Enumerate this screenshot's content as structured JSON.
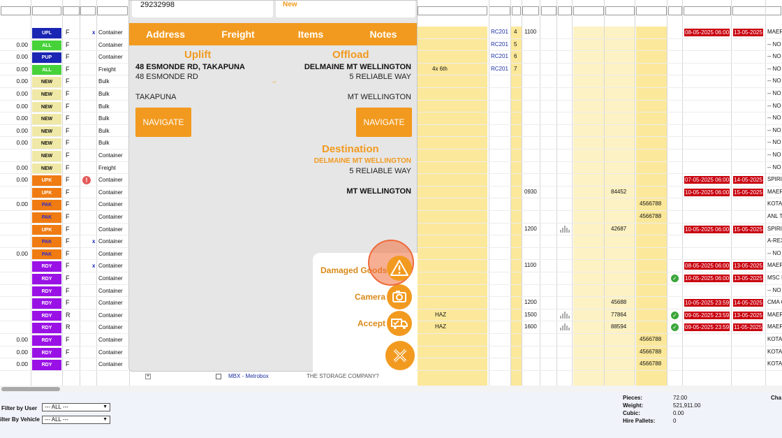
{
  "grid": {
    "rows": [
      {
        "amount": "",
        "status": "UPL",
        "cls": "st-upl",
        "f": "F",
        "type": "Container",
        "mark": "x"
      },
      {
        "amount": "0.00",
        "status": "ALL",
        "cls": "st-all",
        "f": "F",
        "type": "Container"
      },
      {
        "amount": "0.00",
        "status": "PUP",
        "cls": "st-pup",
        "f": "F",
        "type": "Container"
      },
      {
        "amount": "0.00",
        "status": "ALL",
        "cls": "st-all",
        "f": "F",
        "type": "Freight"
      },
      {
        "amount": "0.00",
        "status": "NEW",
        "cls": "st-new",
        "f": "F",
        "type": "Bulk"
      },
      {
        "amount": "0.00",
        "status": "NEW",
        "cls": "st-new",
        "f": "F",
        "type": "Bulk"
      },
      {
        "amount": "0.00",
        "status": "NEW",
        "cls": "st-new",
        "f": "F",
        "type": "Bulk"
      },
      {
        "amount": "0.00",
        "status": "NEW",
        "cls": "st-new",
        "f": "F",
        "type": "Bulk"
      },
      {
        "amount": "0.00",
        "status": "NEW",
        "cls": "st-new",
        "f": "F",
        "type": "Bulk"
      },
      {
        "amount": "0.00",
        "status": "NEW",
        "cls": "st-new",
        "f": "F",
        "type": "Bulk"
      },
      {
        "amount": "",
        "status": "NEW",
        "cls": "st-new",
        "f": "F",
        "type": "Container"
      },
      {
        "amount": "0.00",
        "status": "NEW",
        "cls": "st-new",
        "f": "F",
        "type": "Freight"
      },
      {
        "amount": "0.00",
        "status": "UPK",
        "cls": "st-upk",
        "f": "F",
        "type": "Container",
        "warn": "!"
      },
      {
        "amount": "",
        "status": "UPK",
        "cls": "st-upk",
        "f": "F",
        "type": "Container"
      },
      {
        "amount": "0.00",
        "status": "PAK",
        "cls": "st-pak",
        "f": "F",
        "type": "Container"
      },
      {
        "amount": "",
        "status": "PAK",
        "cls": "st-pak",
        "f": "F",
        "type": "Container"
      },
      {
        "amount": "",
        "status": "UPK",
        "cls": "st-upk",
        "f": "F",
        "type": "Container"
      },
      {
        "amount": "",
        "status": "PAK",
        "cls": "st-pak",
        "f": "F",
        "type": "Container",
        "mark": "x"
      },
      {
        "amount": "0.00",
        "status": "PAK",
        "cls": "st-pak",
        "f": "F",
        "type": "Container"
      },
      {
        "amount": "",
        "status": "RDY",
        "cls": "st-rdy",
        "f": "F",
        "type": "Container",
        "mark": "x"
      },
      {
        "amount": "",
        "status": "RDY",
        "cls": "st-rdy",
        "f": "F",
        "type": "Container"
      },
      {
        "amount": "",
        "status": "RDY",
        "cls": "st-rdy",
        "f": "F",
        "type": "Container"
      },
      {
        "amount": "",
        "status": "RDY",
        "cls": "st-rdy",
        "f": "F",
        "type": "Container"
      },
      {
        "amount": "",
        "status": "RDY",
        "cls": "st-rdy",
        "f": "R",
        "type": "Container"
      },
      {
        "amount": "",
        "status": "RDY",
        "cls": "st-rdy",
        "f": "R",
        "type": "Container"
      },
      {
        "amount": "0.00",
        "status": "RDY",
        "cls": "st-rdy",
        "f": "F",
        "type": "Container"
      },
      {
        "amount": "0.00",
        "status": "RDY",
        "cls": "st-rdy",
        "f": "F",
        "type": "Container"
      },
      {
        "amount": "0.00",
        "status": "RDY",
        "cls": "st-rdy",
        "f": "F",
        "type": "Container"
      }
    ],
    "cells": [
      {
        "text": "RC201",
        "row": 0,
        "col": "rc",
        "link": true
      },
      {
        "text": "4",
        "row": 0,
        "col": "seq"
      },
      {
        "text": "1100",
        "row": 0,
        "col": "time"
      },
      {
        "text": "RC201",
        "row": 1,
        "col": "rc",
        "link": true
      },
      {
        "text": "5",
        "row": 1,
        "col": "seq"
      },
      {
        "text": "RC201",
        "row": 2,
        "col": "rc",
        "link": true
      },
      {
        "text": "6",
        "row": 2,
        "col": "seq"
      },
      {
        "text": "RC201",
        "row": 3,
        "col": "rc",
        "link": true
      },
      {
        "text": "7",
        "row": 3,
        "col": "seq"
      },
      {
        "text": "4x 6th",
        "row": 3,
        "col": "note"
      },
      {
        "text": "0930",
        "row": 13,
        "col": "time"
      },
      {
        "text": "84452",
        "row": 13,
        "col": "num1"
      },
      {
        "text": "4566788",
        "row": 14,
        "col": "num2"
      },
      {
        "text": "4566788",
        "row": 15,
        "col": "num2"
      },
      {
        "text": "1200",
        "row": 16,
        "col": "time"
      },
      {
        "text": "42687",
        "row": 16,
        "col": "num1"
      },
      {
        "text": "1100",
        "row": 19,
        "col": "time"
      },
      {
        "text": "1200",
        "row": 22,
        "col": "time"
      },
      {
        "text": "45688",
        "row": 22,
        "col": "num1"
      },
      {
        "text": "HAZ",
        "row": 23,
        "col": "haz"
      },
      {
        "text": "1500",
        "row": 23,
        "col": "time"
      },
      {
        "text": "77864",
        "row": 23,
        "col": "num1"
      },
      {
        "text": "HAZ",
        "row": 24,
        "col": "haz"
      },
      {
        "text": "1600",
        "row": 24,
        "col": "time"
      },
      {
        "text": "88594",
        "row": 24,
        "col": "num1"
      },
      {
        "text": "4566788",
        "row": 25,
        "col": "num2"
      },
      {
        "text": "4566788",
        "row": 26,
        "col": "num2"
      },
      {
        "text": "4566788",
        "row": 27,
        "col": "num2"
      }
    ],
    "dates": [
      {
        "row": 0,
        "a": "08-05-2025 06:00",
        "b": "13-05-2025",
        "c": "MAER"
      },
      {
        "row": 12,
        "a": "07-05-2025 06:00",
        "b": "14-05-2025",
        "c": "SPIRI"
      },
      {
        "row": 13,
        "a": "10-05-2025 06:00",
        "b": "15-05-2025",
        "c": "MAER"
      },
      {
        "row": 16,
        "a": "10-05-2025 06:00",
        "b": "15-05-2025",
        "c": "SPIRI"
      },
      {
        "row": 19,
        "a": "08-05-2025 06:00",
        "b": "13-05-2025",
        "c": "MAER"
      },
      {
        "row": 20,
        "a": "10-05-2025 06:00",
        "b": "13-05-2025",
        "c": "MSC I"
      },
      {
        "row": 22,
        "a": "10-05-2025 23:59",
        "b": "14-05-2025",
        "c": "CMA C"
      },
      {
        "row": 23,
        "a": "09-05-2025 23:59",
        "b": "13-05-2025",
        "c": "MAER"
      },
      {
        "row": 24,
        "a": "09-05-2025 23:59",
        "b": "11-05-2025",
        "c": "MAER"
      }
    ],
    "right_text": [
      {
        "row": 1,
        "text": "-- NO"
      },
      {
        "row": 2,
        "text": "-- NO"
      },
      {
        "row": 3,
        "text": "-- NO"
      },
      {
        "row": 4,
        "text": "-- NO"
      },
      {
        "row": 5,
        "text": "-- NO"
      },
      {
        "row": 6,
        "text": "-- NO"
      },
      {
        "row": 7,
        "text": "-- NO"
      },
      {
        "row": 8,
        "text": "-- NO"
      },
      {
        "row": 9,
        "text": "-- NO"
      },
      {
        "row": 10,
        "text": "-- NO"
      },
      {
        "row": 11,
        "text": "-- NO"
      },
      {
        "row": 14,
        "text": "KOTA"
      },
      {
        "row": 15,
        "text": "ANL T"
      },
      {
        "row": 17,
        "text": "A-REX"
      },
      {
        "row": 18,
        "text": "-- NO"
      },
      {
        "row": 21,
        "text": "-- NO"
      },
      {
        "row": 25,
        "text": "KOTA"
      },
      {
        "row": 26,
        "text": "KOTA"
      },
      {
        "row": 27,
        "text": "KOTA"
      }
    ],
    "checks": [
      20,
      23,
      24
    ],
    "signal_rows": [
      16,
      23,
      24
    ],
    "bottom_row": {
      "link": "MBX - Metrobox",
      "company": "THE STORAGE COMPANY?"
    }
  },
  "modal": {
    "top_value": "29232998",
    "top_status": "New",
    "tabs": [
      "Address",
      "Freight",
      "Items",
      "Notes"
    ],
    "uplift": {
      "heading": "Uplift",
      "name": "48 ESMONDE RD, TAKAPUNA",
      "line1": "48 ESMONDE RD",
      "suburb": "TAKAPUNA",
      "navigate": "NAVIGATE"
    },
    "offload": {
      "heading": "Offload",
      "name": "DELMAINE MT WELLINGTON",
      "line1": "5 RELIABLE WAY",
      "suburb": "MT WELLINGTON",
      "navigate": "NAVIGATE"
    },
    "arrow": "→",
    "destination": {
      "heading": "Destination",
      "name": "DELMAINE MT WELLINGTON",
      "line1": "5 RELIABLE WAY",
      "suburb": "MT WELLINGTON"
    },
    "actions": {
      "damaged_goods": "Damaged Goods",
      "camera": "Camera",
      "accept": "Accept"
    }
  },
  "footer": {
    "filter_user_label": "Filter by User",
    "filter_user_value": "--- ALL ---",
    "filter_vehicle_label": "ilter By Vehicle",
    "filter_vehicle_value": "--- ALL ---",
    "stats": [
      {
        "label": "Pieces:",
        "value": "72.00"
      },
      {
        "label": "Weight:",
        "value": "521,911.00"
      },
      {
        "label": "Cubic:",
        "value": "0.00"
      },
      {
        "label": "Hire Pallets:",
        "value": "0"
      }
    ],
    "right_label": "Cha"
  },
  "colors": {
    "accent": "#f29a1f",
    "date_red": "#c9000e",
    "yellow": "#fbe89a",
    "rdy_purple": "#9a11e6",
    "upl_blue": "#1a26b3"
  }
}
